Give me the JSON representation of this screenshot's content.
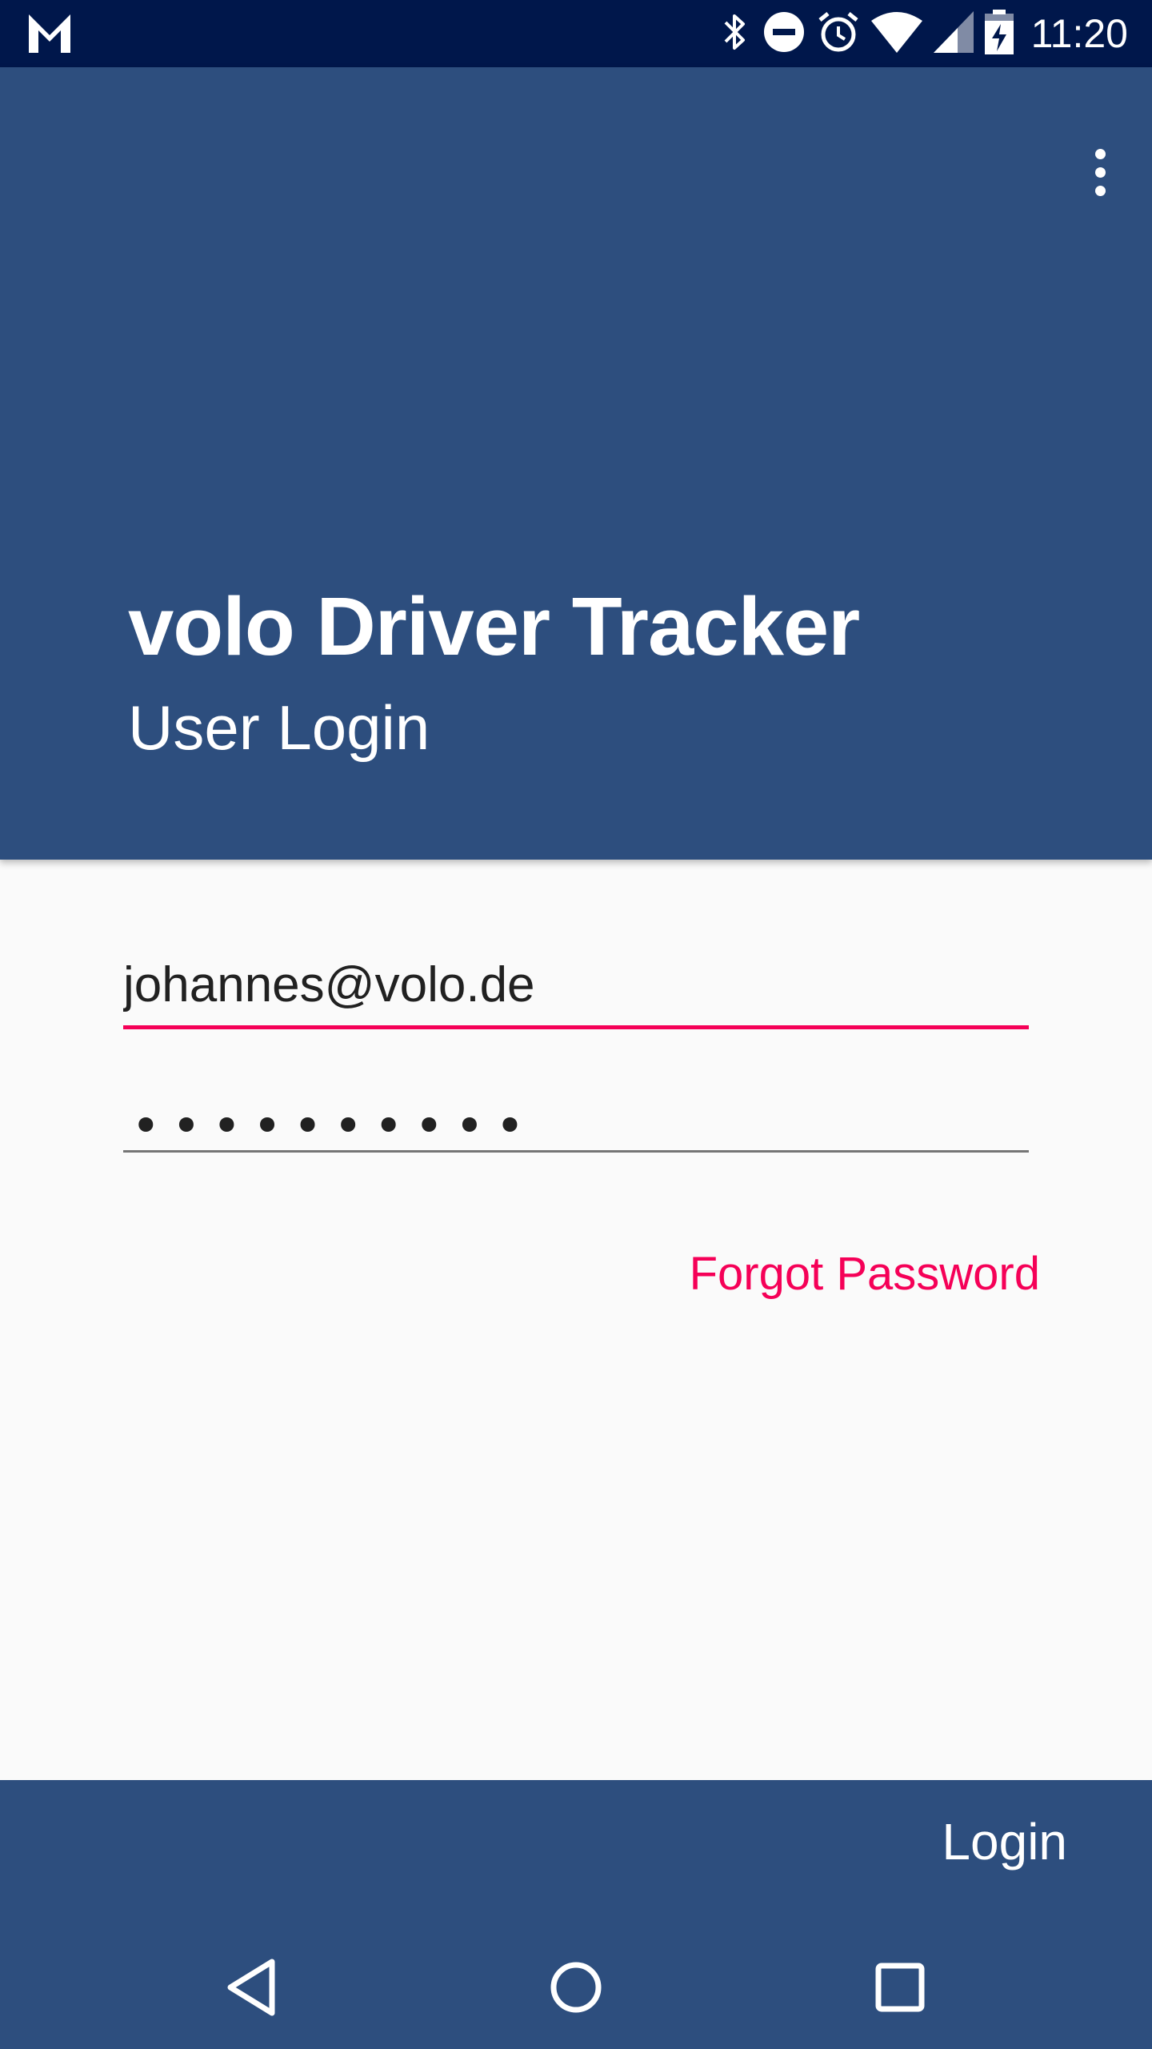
{
  "status_bar": {
    "time": "11:20",
    "icons": [
      "gmail-icon",
      "bluetooth-icon",
      "do-not-disturb-icon",
      "alarm-icon",
      "wifi-icon",
      "cell-signal-icon",
      "battery-charging-icon"
    ]
  },
  "header": {
    "title": "volo Driver Tracker",
    "subtitle": "User Login",
    "menu_icon": "more-vert-icon",
    "background_color": "#2d4e7e"
  },
  "form": {
    "email_value": "johannes@volo.de",
    "password_mask": "••••••••••",
    "forgot_password_label": "Forgot Password",
    "accent_color": "#f50057"
  },
  "bottom_bar": {
    "login_label": "Login"
  },
  "nav_bar": {
    "icons": [
      "back-icon",
      "home-icon",
      "recents-icon"
    ]
  }
}
